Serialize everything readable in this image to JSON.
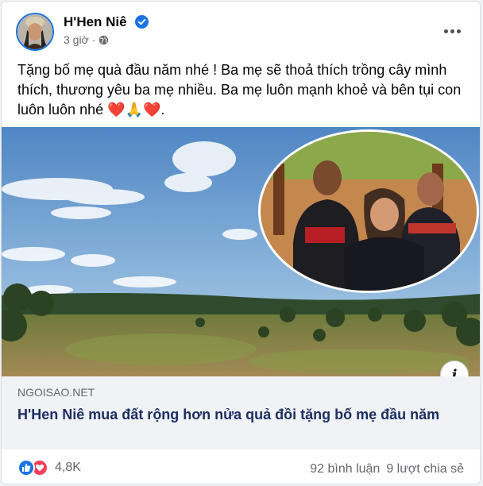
{
  "post": {
    "author": "H'Hen Niê",
    "time": "3 giờ",
    "separator": "·",
    "text_line1": "Tặng bố mẹ quà đầu năm nhé ! Ba mẹ sẽ thoả thích trồng cây mình",
    "text_line2": "thích, thương yêu ba mẹ nhiều. Ba mẹ luôn mạnh khoẻ và bên tụi con",
    "text_line3": "luôn luôn nhé",
    "emoji_1": "❤️",
    "emoji_2": "🙏",
    "emoji_3": "❤️",
    "emoji_end": "."
  },
  "link": {
    "domain": "NGOISAO.NET",
    "title": "H'Hen Niê mua đất rộng hơn nửa quả đồi tặng bố mẹ đầu năm"
  },
  "footer": {
    "reaction_count": "4,8K",
    "comments": "92 bình luận",
    "shares": "9 lượt chia sẻ"
  },
  "icons": {
    "more": "more-options-icon",
    "info": "i",
    "verified": "verified-badge-icon",
    "privacy": "globe-icon",
    "like": "like-reaction-icon",
    "love": "love-reaction-icon"
  },
  "colors": {
    "accent": "#1b74e4",
    "love": "#f33e58",
    "link_title": "#1c2f62",
    "muted": "#65676b"
  }
}
